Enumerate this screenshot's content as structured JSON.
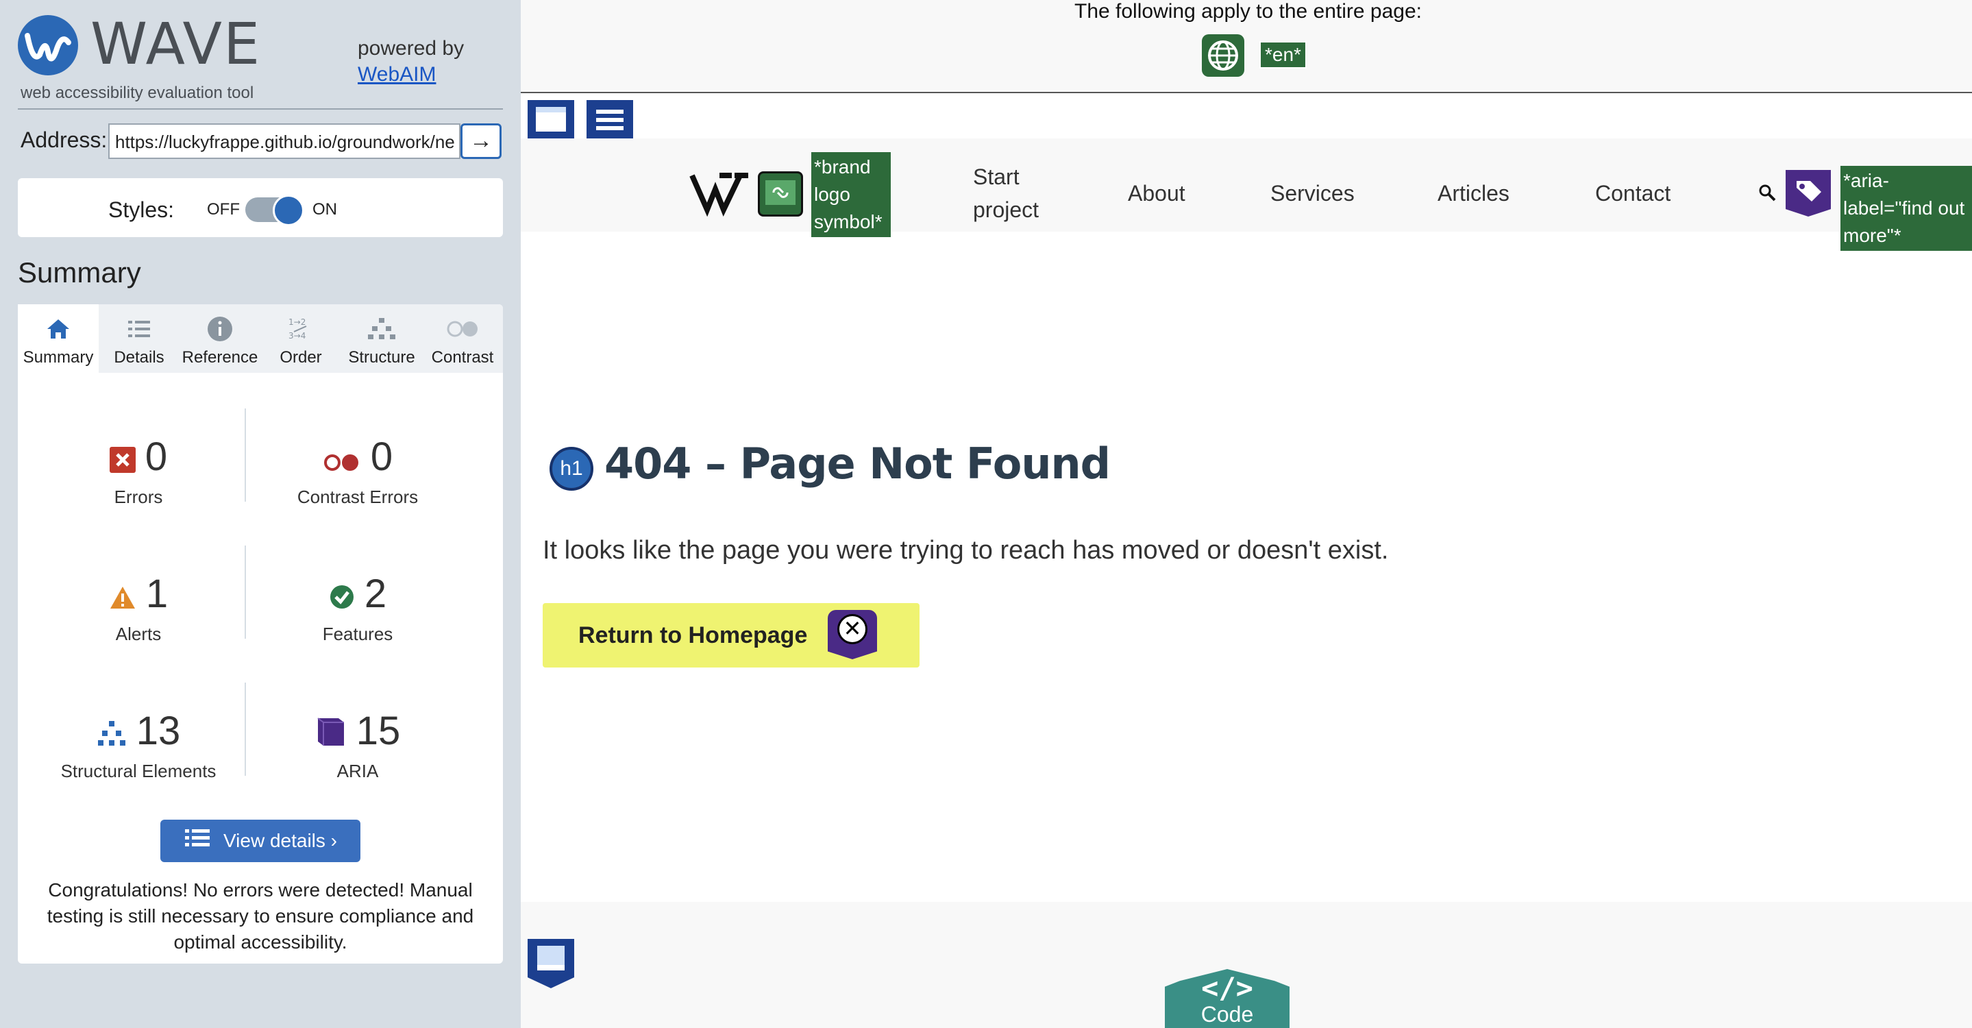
{
  "sidebar": {
    "brand": "WAVE",
    "tagline": "web accessibility evaluation tool",
    "powered_by": "powered by",
    "powered_link": "WebAIM",
    "address_label": "Address:",
    "address_value": "https://luckyfrappe.github.io/groundwork/ne",
    "go_label": "→",
    "styles_label": "Styles:",
    "styles_off": "OFF",
    "styles_on": "ON",
    "styles_state": "on",
    "summary_title": "Summary",
    "tabs": [
      {
        "label": "Summary",
        "icon": "home-icon",
        "active": true
      },
      {
        "label": "Details",
        "icon": "list-icon",
        "active": false
      },
      {
        "label": "Reference",
        "icon": "info-icon",
        "active": false
      },
      {
        "label": "Order",
        "icon": "order-icon",
        "active": false
      },
      {
        "label": "Structure",
        "icon": "structure-icon",
        "active": false
      },
      {
        "label": "Contrast",
        "icon": "contrast-icon",
        "active": false
      }
    ],
    "stats": {
      "errors": {
        "value": "0",
        "label": "Errors",
        "color": "#c0392b"
      },
      "contrast": {
        "value": "0",
        "label": "Contrast Errors",
        "color": "#b03030"
      },
      "alerts": {
        "value": "1",
        "label": "Alerts",
        "color": "#e08a2b"
      },
      "features": {
        "value": "2",
        "label": "Features",
        "color": "#2d7a4b"
      },
      "structural": {
        "value": "13",
        "label": "Structural Elements",
        "color": "#2b68b5"
      },
      "aria": {
        "value": "15",
        "label": "ARIA",
        "color": "#4a2a86"
      }
    },
    "view_details": "View details ›",
    "congrats": "Congratulations! No errors were detected! Manual testing is still necessary to ensure compliance and optimal accessibility."
  },
  "page": {
    "top_note": "The following apply to the entire page:",
    "lang_tag": "*en*",
    "nav": {
      "brand_tag": "*brand logo symbol*",
      "items": [
        "Start project",
        "About",
        "Services",
        "Articles",
        "Contact"
      ],
      "aria_tag": "*aria-label=\"find out more\"*"
    },
    "h1_badge": "h1",
    "heading": "404 – Page Not Found",
    "paragraph": "It looks like the page you were trying to reach has moved or doesn't exist.",
    "home_button": "Return to Homepage",
    "code_tab": "Code",
    "code_glyph": "</>"
  }
}
